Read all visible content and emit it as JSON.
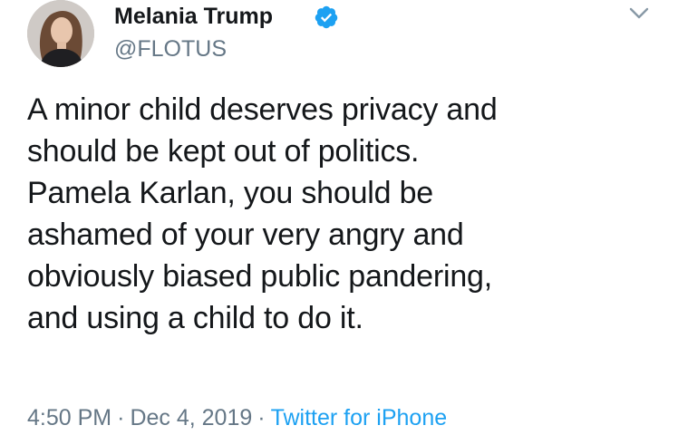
{
  "author": {
    "display_name": "Melania Trump",
    "handle": "@FLOTUS",
    "verified": true
  },
  "tweet": {
    "lines": [
      "A minor child deserves privacy and",
      "should be kept out of politics.",
      "Pamela Karlan, you should be",
      "ashamed of your very angry and",
      "obviously biased public pandering,",
      "and using a child to do it."
    ]
  },
  "meta": {
    "time": "4:50 PM",
    "separator": "·",
    "date": "Dec 4, 2019",
    "source": "Twitter for iPhone"
  },
  "icons": {
    "verified": "verified-badge-icon",
    "more": "chevron-down-icon"
  },
  "colors": {
    "text": "#14171a",
    "secondary": "#657786",
    "accent": "#1da1f2"
  }
}
